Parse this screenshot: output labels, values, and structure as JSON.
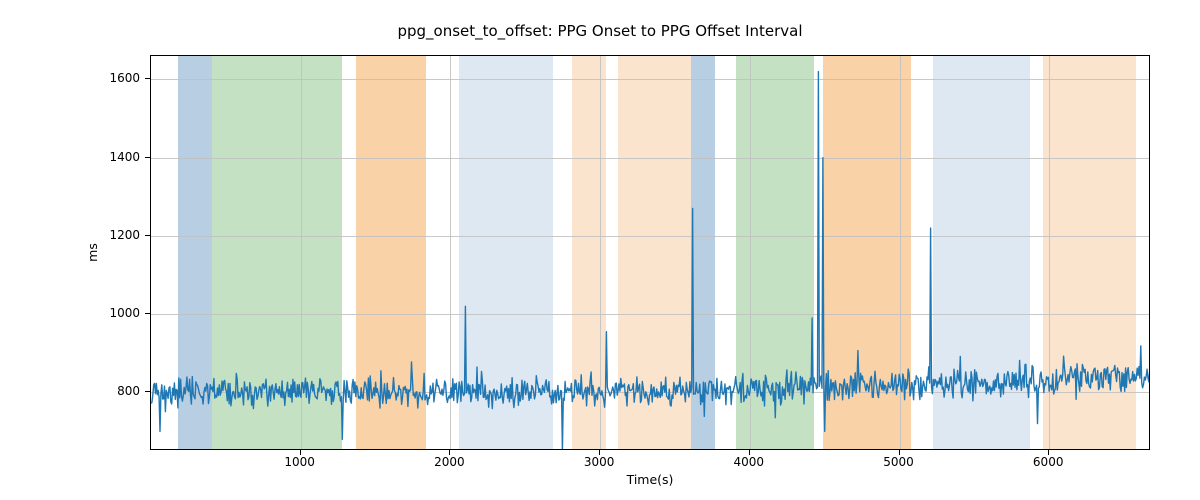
{
  "chart_data": {
    "type": "line",
    "title": "ppg_onset_to_offset: PPG Onset to PPG Offset Interval",
    "xlabel": "Time(s)",
    "ylabel": "ms",
    "xlim": [
      0,
      6680
    ],
    "ylim": [
      650,
      1660
    ],
    "xticks": [
      1000,
      2000,
      3000,
      4000,
      5000,
      6000
    ],
    "yticks": [
      800,
      1000,
      1200,
      1400,
      1600
    ],
    "grid": true,
    "line_color": "#1f77b4",
    "background_bands": [
      {
        "x0": 180,
        "x1": 410,
        "color": "#b7cee3"
      },
      {
        "x0": 410,
        "x1": 1275,
        "color": "#c5e1c3"
      },
      {
        "x0": 1275,
        "x1": 1370,
        "color": "#ffffff"
      },
      {
        "x0": 1370,
        "x1": 1840,
        "color": "#fad2a7"
      },
      {
        "x0": 1840,
        "x1": 2060,
        "color": "#ffffff"
      },
      {
        "x0": 2060,
        "x1": 2685,
        "color": "#dee8f2"
      },
      {
        "x0": 2685,
        "x1": 2815,
        "color": "#ffffff"
      },
      {
        "x0": 2815,
        "x1": 3040,
        "color": "#fae4cd"
      },
      {
        "x0": 3040,
        "x1": 3120,
        "color": "#ffffff"
      },
      {
        "x0": 3120,
        "x1": 3610,
        "color": "#fae4cd"
      },
      {
        "x0": 3610,
        "x1": 3770,
        "color": "#b7cee3"
      },
      {
        "x0": 3770,
        "x1": 3910,
        "color": "#ffffff"
      },
      {
        "x0": 3910,
        "x1": 4430,
        "color": "#c5e1c3"
      },
      {
        "x0": 4430,
        "x1": 4490,
        "color": "#ffffff"
      },
      {
        "x0": 4490,
        "x1": 5075,
        "color": "#fad2a7"
      },
      {
        "x0": 5075,
        "x1": 5225,
        "color": "#ffffff"
      },
      {
        "x0": 5225,
        "x1": 5870,
        "color": "#dee8f2"
      },
      {
        "x0": 5870,
        "x1": 5960,
        "color": "#ffffff"
      },
      {
        "x0": 5960,
        "x1": 6580,
        "color": "#fae4cd"
      }
    ],
    "series": [
      {
        "name": "ppg_onset_to_offset",
        "approx_baseline_ms": 800,
        "approx_noise_amp_ms": 45,
        "spikes": [
          {
            "x": 60,
            "y": 700
          },
          {
            "x": 1280,
            "y": 680
          },
          {
            "x": 2100,
            "y": 1020
          },
          {
            "x": 2750,
            "y": 650
          },
          {
            "x": 3040,
            "y": 955
          },
          {
            "x": 3620,
            "y": 1270
          },
          {
            "x": 4415,
            "y": 990
          },
          {
            "x": 4455,
            "y": 1620
          },
          {
            "x": 4490,
            "y": 1400
          },
          {
            "x": 4500,
            "y": 700
          },
          {
            "x": 5210,
            "y": 1220
          },
          {
            "x": 5920,
            "y": 720
          }
        ]
      }
    ]
  }
}
